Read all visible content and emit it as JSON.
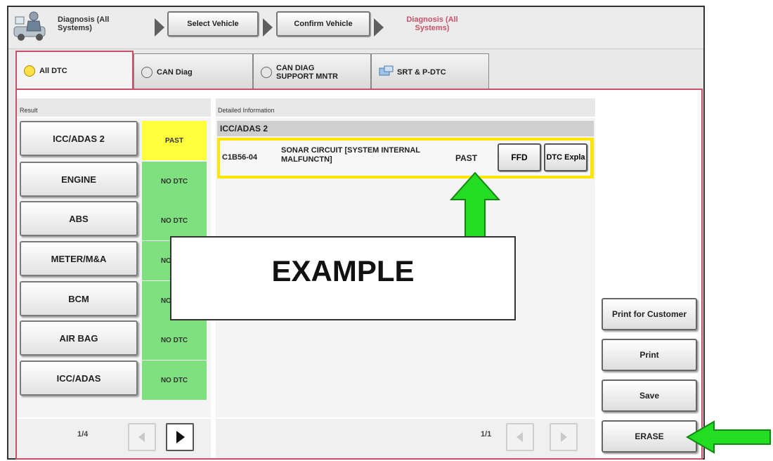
{
  "breadcrumb": {
    "home_label": "Diagnosis (All Systems)",
    "step1": "Select Vehicle",
    "step2": "Confirm Vehicle",
    "current": "Diagnosis (All Systems)"
  },
  "tabs": [
    {
      "label": "All DTC",
      "active": true
    },
    {
      "label": "CAN Diag",
      "active": false
    },
    {
      "label": "CAN DIAG SUPPORT MNTR",
      "active": false
    },
    {
      "label": "SRT & P-DTC",
      "active": false
    }
  ],
  "result": {
    "section_label": "Result",
    "rows": [
      {
        "system": "ICC/ADAS 2",
        "status": "PAST"
      },
      {
        "system": "ENGINE",
        "status": "NO DTC"
      },
      {
        "system": "ABS",
        "status": "NO DTC"
      },
      {
        "system": "METER/M&A",
        "status": "NO DTC"
      },
      {
        "system": "BCM",
        "status": "NO DTC"
      },
      {
        "system": "AIR BAG",
        "status": "NO DTC"
      },
      {
        "system": "ICC/ADAS",
        "status": "NO DTC"
      }
    ],
    "page": "1/4"
  },
  "detail": {
    "section_label": "Detailed Information",
    "header": "ICC/ADAS 2",
    "dtc_code": "C1B56-04",
    "dtc_desc": "SONAR CIRCUIT [SYSTEM INTERNAL MALFUNCTN]",
    "dtc_status": "PAST",
    "ffd_label": "FFD",
    "expla_label": "DTC Expla",
    "page": "1/1"
  },
  "side_buttons": {
    "print_customer": "Print for Customer",
    "print": "Print",
    "save": "Save",
    "erase": "ERASE"
  },
  "overlay": {
    "text": "EXAMPLE"
  },
  "colors": {
    "past": "#ffff3c",
    "no_dtc": "#7ee07e",
    "tab_border": "#c8506a",
    "arrow": "#22dd22",
    "detail_highlight": "#ffe600"
  }
}
